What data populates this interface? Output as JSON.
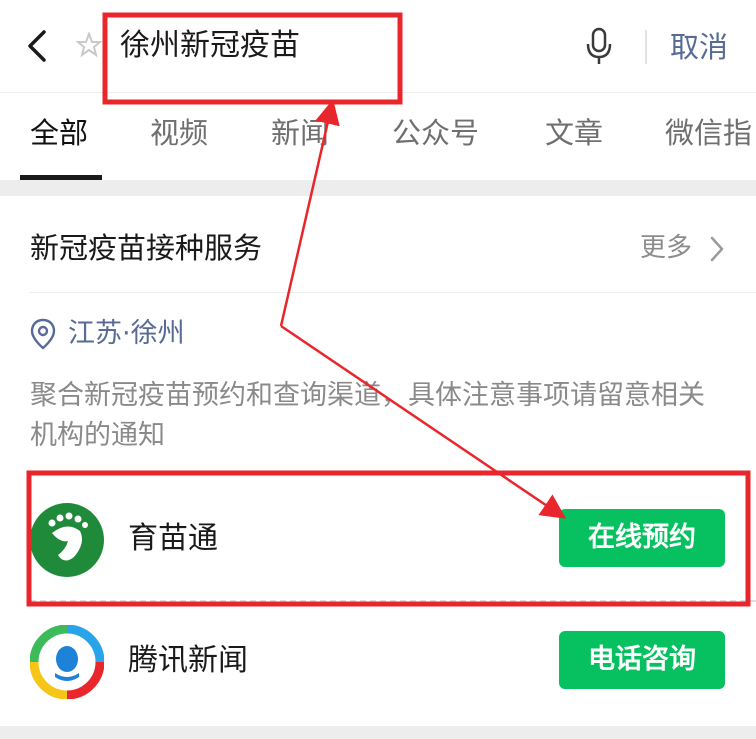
{
  "search": {
    "query": "徐州新冠疫苗",
    "cancel_label": "取消"
  },
  "tabs": [
    {
      "label": "全部",
      "active": true
    },
    {
      "label": "视频",
      "active": false
    },
    {
      "label": "新闻",
      "active": false
    },
    {
      "label": "公众号",
      "active": false
    },
    {
      "label": "文章",
      "active": false
    },
    {
      "label": "微信指",
      "active": false
    }
  ],
  "card": {
    "title": "新冠疫苗接种服务",
    "more_label": "更多",
    "location": "江苏·徐州",
    "description": "聚合新冠疫苗预约和查询渠道，具体注意事项请留意相关机构的通知",
    "services": [
      {
        "name": "育苗通",
        "action": "在线预约",
        "icon": "yumiaotong-logo-icon"
      },
      {
        "name": "腾讯新闻",
        "action": "电话咨询",
        "icon": "tencent-news-logo-icon"
      }
    ]
  },
  "colors": {
    "accent_green": "#07c160",
    "link_blue": "#576b95",
    "annotation_red": "#e8262b"
  }
}
